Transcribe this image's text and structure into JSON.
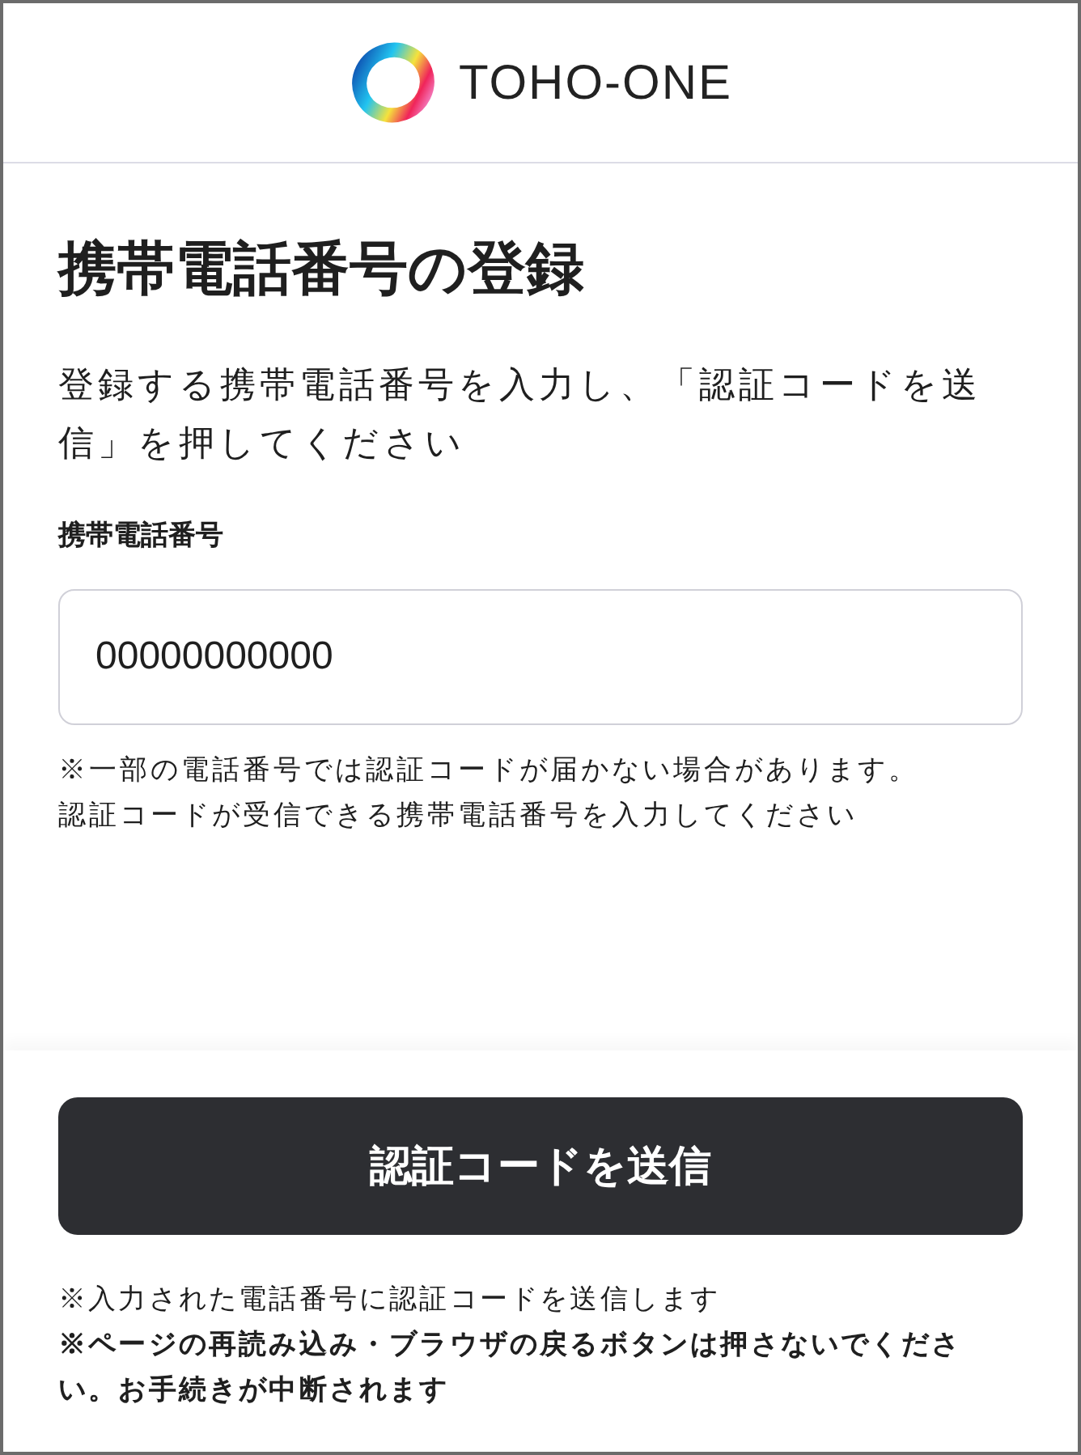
{
  "header": {
    "brand": "TOHO-ONE"
  },
  "title": "携帯電話番号の登録",
  "description": "登録する携帯電話番号を入力し、「認証コードを送信」を押してください",
  "phone_field": {
    "label": "携帯電話番号",
    "value": "00000000000"
  },
  "hints": [
    "※一部の電話番号では認証コードが届かない場合があります。",
    "認証コードが受信できる携帯電話番号を入力してください"
  ],
  "submit_button": "認証コードを送信",
  "notes": [
    {
      "text": "※入力された電話番号に認証コードを送信します",
      "bold": false
    },
    {
      "text": "※ページの再読み込み・ブラウザの戻るボタンは押さないでください。お手続きが中断されます",
      "bold": true
    }
  ]
}
